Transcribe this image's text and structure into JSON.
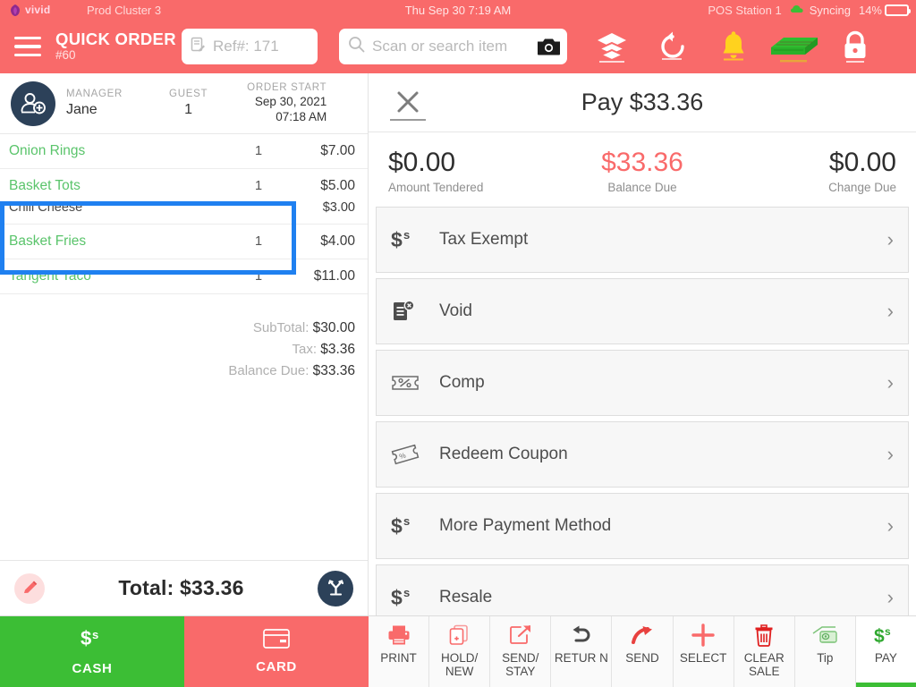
{
  "statusbar": {
    "brand": "vivid",
    "cluster": "Prod Cluster 3",
    "datetime": "Thu Sep 30 7:19 AM",
    "station": "POS Station 1",
    "sync": "Syncing",
    "battery": "14%",
    "battery_pct": 14
  },
  "header": {
    "order_type": "QUICK ORDER",
    "order_number": "#60",
    "ref_value": "Ref#: 171",
    "search_placeholder": "Scan or search item",
    "icons": [
      "layers-icon",
      "refresh-undo-icon",
      "bell-icon",
      "cash-stack-icon",
      "lock-icon"
    ]
  },
  "customer": {
    "manager_label": "MANAGER",
    "manager_name": "Jane",
    "guest_label": "GUEST",
    "guest_count": "1",
    "start_label": "ORDER START",
    "start_date": "Sep 30, 2021",
    "start_time": "07:18 AM"
  },
  "order_items": [
    {
      "name": "Onion Rings",
      "qty": "1",
      "price": "$7.00",
      "modifier": null,
      "modifier_price": null
    },
    {
      "name": "Basket Tots",
      "qty": "1",
      "price": "$5.00",
      "modifier": "Chili Cheese",
      "modifier_price": "$3.00"
    },
    {
      "name": "Basket Fries",
      "qty": "1",
      "price": "$4.00",
      "modifier": null,
      "modifier_price": null
    },
    {
      "name": "Tangent Taco",
      "qty": "1",
      "price": "$11.00",
      "modifier": null,
      "modifier_price": null
    }
  ],
  "totals": {
    "subtotal_label": "SubTotal:",
    "subtotal": "$30.00",
    "tax_label": "Tax:",
    "tax": "$3.36",
    "balance_label": "Balance Due:",
    "balance": "$33.36",
    "total_line": "Total: $33.36"
  },
  "pay_panel": {
    "title": "Pay $33.36",
    "amount_tendered": "$0.00",
    "amount_tendered_label": "Amount Tendered",
    "balance_due": "$33.36",
    "balance_due_label": "Balance Due",
    "change_due": "$0.00",
    "change_due_label": "Change Due",
    "options": [
      {
        "label": "Tax Exempt",
        "icon": "dollar-sign-icon",
        "chevron": "›"
      },
      {
        "label": "Void",
        "icon": "void-doc-icon",
        "chevron": "›"
      },
      {
        "label": "Comp",
        "icon": "percent-ticket-icon",
        "chevron": "›"
      },
      {
        "label": "Redeem Coupon",
        "icon": "coupon-icon",
        "chevron": "›"
      },
      {
        "label": "More Payment Method",
        "icon": "dollar-sign-icon",
        "chevron": "›"
      },
      {
        "label": "Resale",
        "icon": "dollar-sign-icon",
        "chevron": "›"
      }
    ],
    "selected_option": "Void"
  },
  "bottom_bar": {
    "cash_label": "CASH",
    "card_label": "CARD",
    "tools": [
      {
        "label": "PRINT",
        "icon": "printer-icon",
        "active": false
      },
      {
        "label": "HOLD/ NEW",
        "icon": "hold-new-icon",
        "active": false
      },
      {
        "label": "SEND/ STAY",
        "icon": "send-stay-icon",
        "active": false
      },
      {
        "label": "RETUR N",
        "icon": "return-icon",
        "active": false
      },
      {
        "label": "SEND",
        "icon": "send-arrow-icon",
        "active": false
      },
      {
        "label": "SELECT",
        "icon": "plus-icon",
        "active": false
      },
      {
        "label": "CLEAR SALE",
        "icon": "trash-icon",
        "active": false
      },
      {
        "label": "Tip",
        "icon": "money-icon",
        "active": false
      },
      {
        "label": "PAY",
        "icon": "dollar-sign-icon",
        "active": true
      }
    ]
  },
  "colors": {
    "header_red": "#f96a6a",
    "green": "#3cbe35",
    "item_green": "#5ac46b",
    "selection_blue": "#1f80f0",
    "navy": "#2c4159"
  }
}
